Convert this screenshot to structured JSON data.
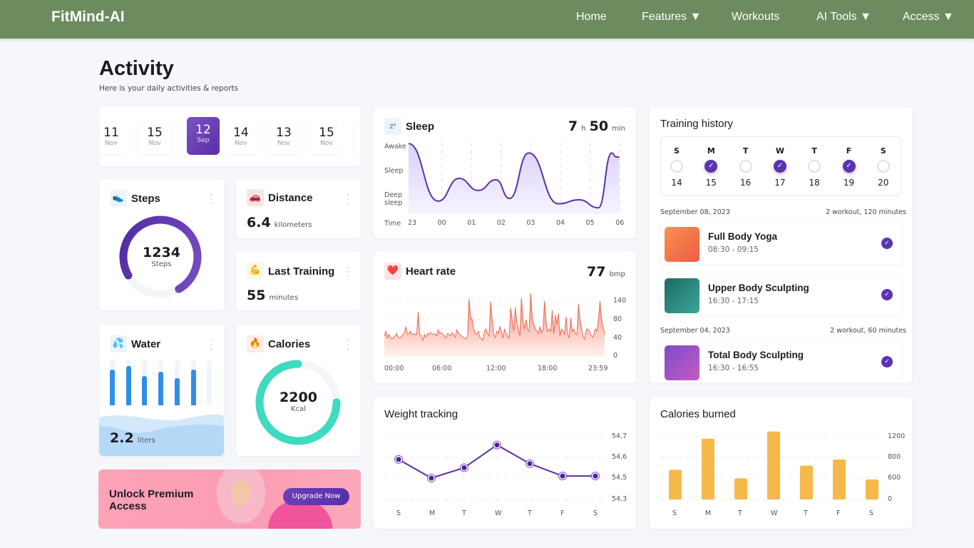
{
  "nav": {
    "brand": "FitMind-AI",
    "items": [
      "Home",
      "Features ▼",
      "Workouts",
      "AI Tools ▼",
      "Access ▼"
    ]
  },
  "header": {
    "title": "Activity",
    "subtitle": "Here is your daily activities & reports"
  },
  "dates": [
    {
      "d": "11",
      "m": "Nov"
    },
    {
      "d": "15",
      "m": "Nov"
    },
    {
      "d": "12",
      "m": "Sep",
      "selected": true
    },
    {
      "d": "14",
      "m": "Nov"
    },
    {
      "d": "13",
      "m": "Nov"
    },
    {
      "d": "15",
      "m": "Nov"
    }
  ],
  "steps": {
    "title": "Steps",
    "value": "1234",
    "label": "Steps",
    "progress": 0.75
  },
  "distance": {
    "title": "Distance",
    "value": "6.4",
    "unit": "kilometers"
  },
  "last_training": {
    "title": "Last Training",
    "value": "55",
    "unit": "minutes"
  },
  "water": {
    "title": "Water",
    "value": "2.2",
    "unit": "liters",
    "bars": [
      0.8,
      0.87,
      0.65,
      0.74,
      0.6,
      0.8,
      0
    ]
  },
  "calories": {
    "title": "Calories",
    "value": "2200",
    "unit": "Kcal",
    "progress": 0.75
  },
  "premium": {
    "title": "Unlock Premium Access",
    "button": "Upgrade Now"
  },
  "sleep": {
    "title": "Sleep",
    "hours": "7",
    "h": "h",
    "minutes": "50",
    "min": "min",
    "ylabels": [
      "Awake",
      "Sleep",
      "Deep sleep",
      "Time"
    ],
    "xlabels": [
      "23",
      "00",
      "01",
      "02",
      "03",
      "04",
      "05",
      "06"
    ],
    "points": [
      [
        0,
        3.1
      ],
      [
        1,
        0.95
      ],
      [
        1.7,
        1.8
      ],
      [
        2.35,
        1.35
      ],
      [
        2.95,
        1.75
      ],
      [
        3.4,
        1.05
      ],
      [
        4.05,
        2.75
      ],
      [
        5.05,
        0.85
      ],
      [
        5.75,
        1.0
      ],
      [
        6.4,
        0.7
      ],
      [
        6.85,
        2.75
      ],
      [
        7.0,
        2.6
      ],
      [
        7.1,
        2.6
      ]
    ]
  },
  "heart": {
    "title": "Heart rate",
    "value": "77",
    "unit": "bmp",
    "yticks": [
      "140",
      "80",
      "40",
      "0"
    ],
    "xlabels": [
      "00:00",
      "06:00",
      "12:00",
      "18:00",
      "23:59"
    ],
    "values": [
      45,
      55,
      40,
      48,
      42,
      38,
      40,
      45,
      50,
      42,
      40,
      44,
      48,
      52,
      65,
      48,
      50,
      55,
      48,
      50,
      48,
      48,
      105,
      48,
      45,
      35,
      48,
      42,
      50,
      48,
      52,
      50,
      48,
      50,
      45,
      58,
      50,
      52,
      48,
      45,
      40,
      50,
      48,
      45,
      52,
      48,
      42,
      58,
      52,
      48,
      45,
      42,
      40,
      38,
      45,
      148,
      90,
      80,
      60,
      50,
      48,
      55,
      42,
      40,
      35,
      55,
      60,
      50,
      45,
      138,
      80,
      48,
      42,
      55,
      50,
      65,
      55,
      40,
      60,
      50,
      45,
      40,
      118,
      80,
      55,
      120,
      75,
      60,
      45,
      150,
      80,
      60,
      80,
      58,
      55,
      165,
      90,
      70,
      60,
      55,
      50,
      65,
      52,
      60,
      140,
      75,
      55,
      60,
      55,
      110,
      50,
      95,
      70,
      100,
      45,
      60,
      55,
      48,
      90,
      50,
      40,
      85,
      55,
      60,
      50,
      48,
      130,
      80,
      60,
      45,
      38,
      58,
      60,
      55,
      48,
      42,
      48,
      60,
      55,
      85,
      140,
      80,
      65,
      48
    ]
  },
  "weight": {
    "title": "Weight tracking",
    "days": [
      "S",
      "M",
      "T",
      "W",
      "T",
      "F",
      "S"
    ],
    "yticks": [
      "54,7",
      "54,6",
      "54,5",
      "54,3"
    ],
    "values": [
      54.59,
      54.5,
      54.55,
      54.66,
      54.57,
      54.51,
      54.51
    ]
  },
  "burned": {
    "title": "Calories burned",
    "days": [
      "S",
      "M",
      "T",
      "W",
      "T",
      "F",
      "S"
    ],
    "yticks": [
      "1200",
      "800",
      "600",
      "0"
    ],
    "values": [
      680,
      1160,
      590,
      1300,
      720,
      780,
      560
    ]
  },
  "history": {
    "title": "Training history",
    "week": [
      {
        "day": "S",
        "date": "14",
        "done": false
      },
      {
        "day": "M",
        "date": "15",
        "done": true
      },
      {
        "day": "T",
        "date": "16",
        "done": false
      },
      {
        "day": "W",
        "date": "17",
        "done": true
      },
      {
        "day": "T",
        "date": "18",
        "done": false
      },
      {
        "day": "F",
        "date": "19",
        "done": true
      },
      {
        "day": "S",
        "date": "20",
        "done": false
      }
    ],
    "groups": [
      {
        "date": "September 08, 2023",
        "summary": "2 workout, 120 minutes",
        "items": [
          {
            "name": "Full Body Yoga",
            "time": "08:30 - 09:15"
          },
          {
            "name": "Upper Body Sculpting",
            "time": "16:30 - 17:15"
          }
        ]
      },
      {
        "date": "September 04, 2023",
        "summary": "2 workout, 60 minutes",
        "items": [
          {
            "name": "Total Body Sculpting",
            "time": "16:30 - 16:55"
          }
        ]
      }
    ]
  },
  "colors": {
    "nav": "#6c8b5f",
    "purple": "#5b34b0",
    "teal": "#3fdac0",
    "water": "#2f8fe8",
    "heart": "#f0705e",
    "bars": "#f5b94a"
  }
}
